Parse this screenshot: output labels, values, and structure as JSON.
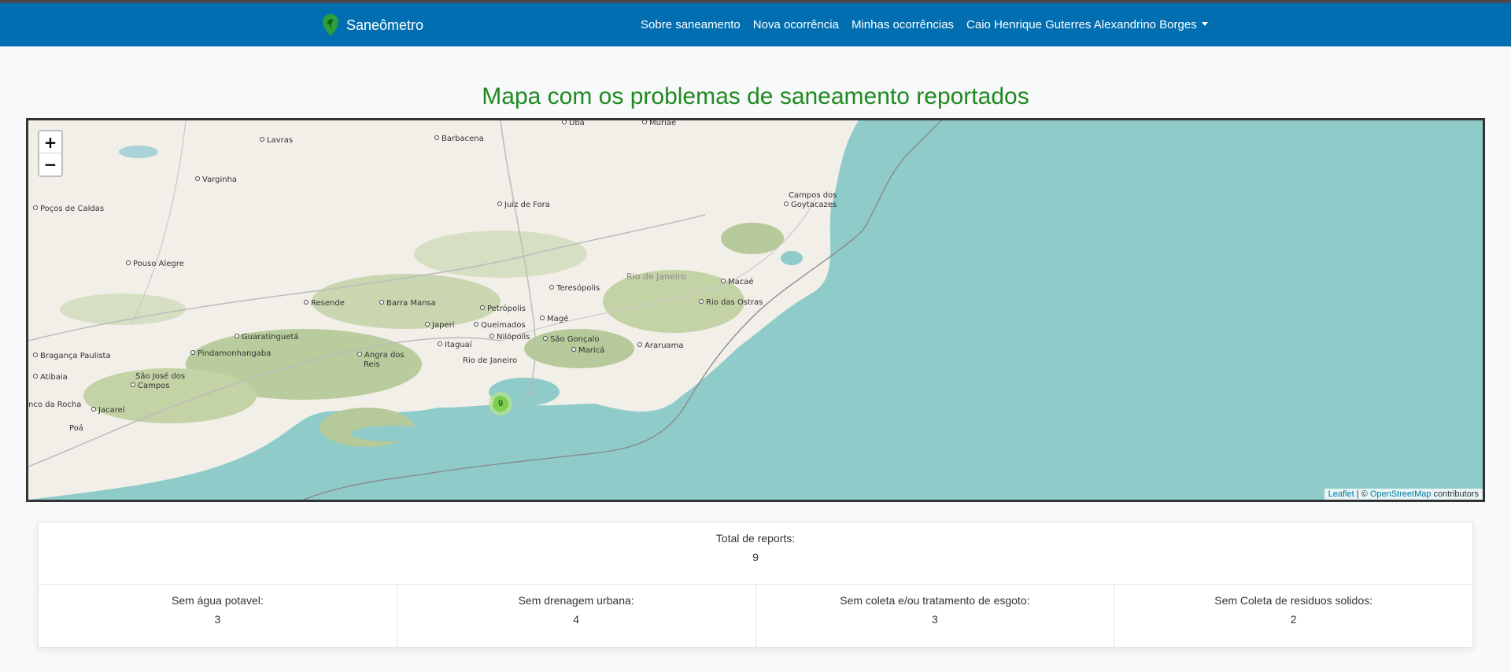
{
  "navbar": {
    "brand": "Saneômetro",
    "links": [
      "Sobre saneamento",
      "Nova ocorrência",
      "Minhas ocorrências"
    ],
    "user": "Caio Henrique Guterres Alexandrino Borges"
  },
  "page_title": "Mapa com os problemas de saneamento reportados",
  "map": {
    "zoom_in": "+",
    "zoom_out": "−",
    "region_label": "Rio de Janeiro",
    "places": [
      "Ubá",
      "Muriaé",
      "Lavras",
      "Barbacena",
      "Varginha",
      "Juiz de Fora",
      "Poços de Caldas",
      "Campos dos",
      "Goytacazes",
      "Pouso Alegre",
      "Macaé",
      "Teresópolis",
      "Rio das Ostras",
      "Resende",
      "Barra Mansa",
      "Petrópolis",
      "Magé",
      "Japeri",
      "Queimados",
      "Guaratinguetá",
      "Nilópolis",
      "São Gonçalo",
      "Itaguaí",
      "Maricá",
      "Araruama",
      "Pindamonhangaba",
      "Angra dos",
      "Reis",
      "Rio de Janeiro",
      "Bragança Paulista",
      "São José dos",
      "Campos",
      "Atibaia",
      "nco da Rocha",
      "Jacareí",
      "Poá"
    ],
    "cluster_count": "9",
    "attribution": {
      "leaflet": "Leaflet",
      "sep": " | © ",
      "osm": "OpenStreetMap",
      "suffix": " contributors"
    },
    "colors": {
      "water": "#8ecbc9",
      "land": "#f2efe9",
      "forest": "#b5c99a",
      "cluster": "#6ecc39"
    }
  },
  "stats": {
    "total_label": "Total de reports:",
    "total_value": "9",
    "categories": [
      {
        "label": "Sem água potavel:",
        "value": "3"
      },
      {
        "label": "Sem drenagem urbana:",
        "value": "4"
      },
      {
        "label": "Sem coleta e/ou tratamento de esgoto:",
        "value": "3"
      },
      {
        "label": "Sem Coleta de residuos solidos:",
        "value": "2"
      }
    ]
  }
}
